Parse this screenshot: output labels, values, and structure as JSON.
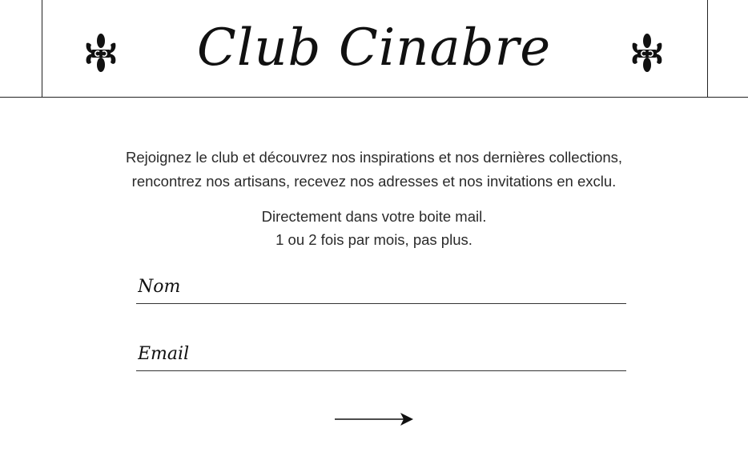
{
  "brand": {
    "title": "Club Cinabre",
    "emblem_icon": "fleur-de-lis-monogram-icon"
  },
  "intro": {
    "line1": "Rejoignez le club et découvrez nos inspirations et nos dernières collections,",
    "line2": "rencontrez nos artisans, recevez nos adresses et nos invitations en exclu."
  },
  "cadence": {
    "line1": "Directement dans votre boite mail.",
    "line2": "1 ou 2 fois par mois, pas plus."
  },
  "form": {
    "nom_placeholder": "Nom",
    "nom_value": "",
    "email_placeholder": "Email",
    "email_value": "",
    "submit_icon": "arrow-right-icon"
  },
  "colors": {
    "ink": "#111111",
    "background": "#ffffff"
  }
}
